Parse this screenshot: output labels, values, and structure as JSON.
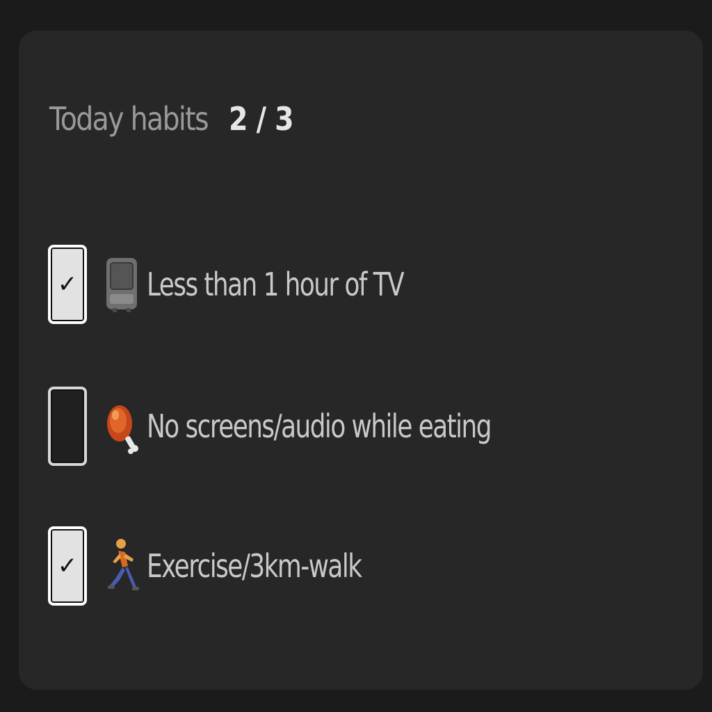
{
  "header": {
    "label": "Today habits",
    "count": "2 / 3"
  },
  "habits": [
    {
      "label": "Less than 1 hour of TV",
      "checked": true,
      "checkmark": "✓",
      "icon": "television-icon"
    },
    {
      "label": "No screens/audio while eating",
      "checked": false,
      "checkmark": "",
      "icon": "meat-on-bone-icon"
    },
    {
      "label": "Exercise/3km-walk",
      "checked": true,
      "checkmark": "✓",
      "icon": "running-person-icon"
    }
  ],
  "colors": {
    "page_bg": "#1b1b1b",
    "card_bg": "#272727",
    "label_text": "#c9c9c9",
    "header_text": "#9a9a9a",
    "count_text": "#e6e6e6",
    "checkbox_checked_bg": "#e2e2e2"
  }
}
